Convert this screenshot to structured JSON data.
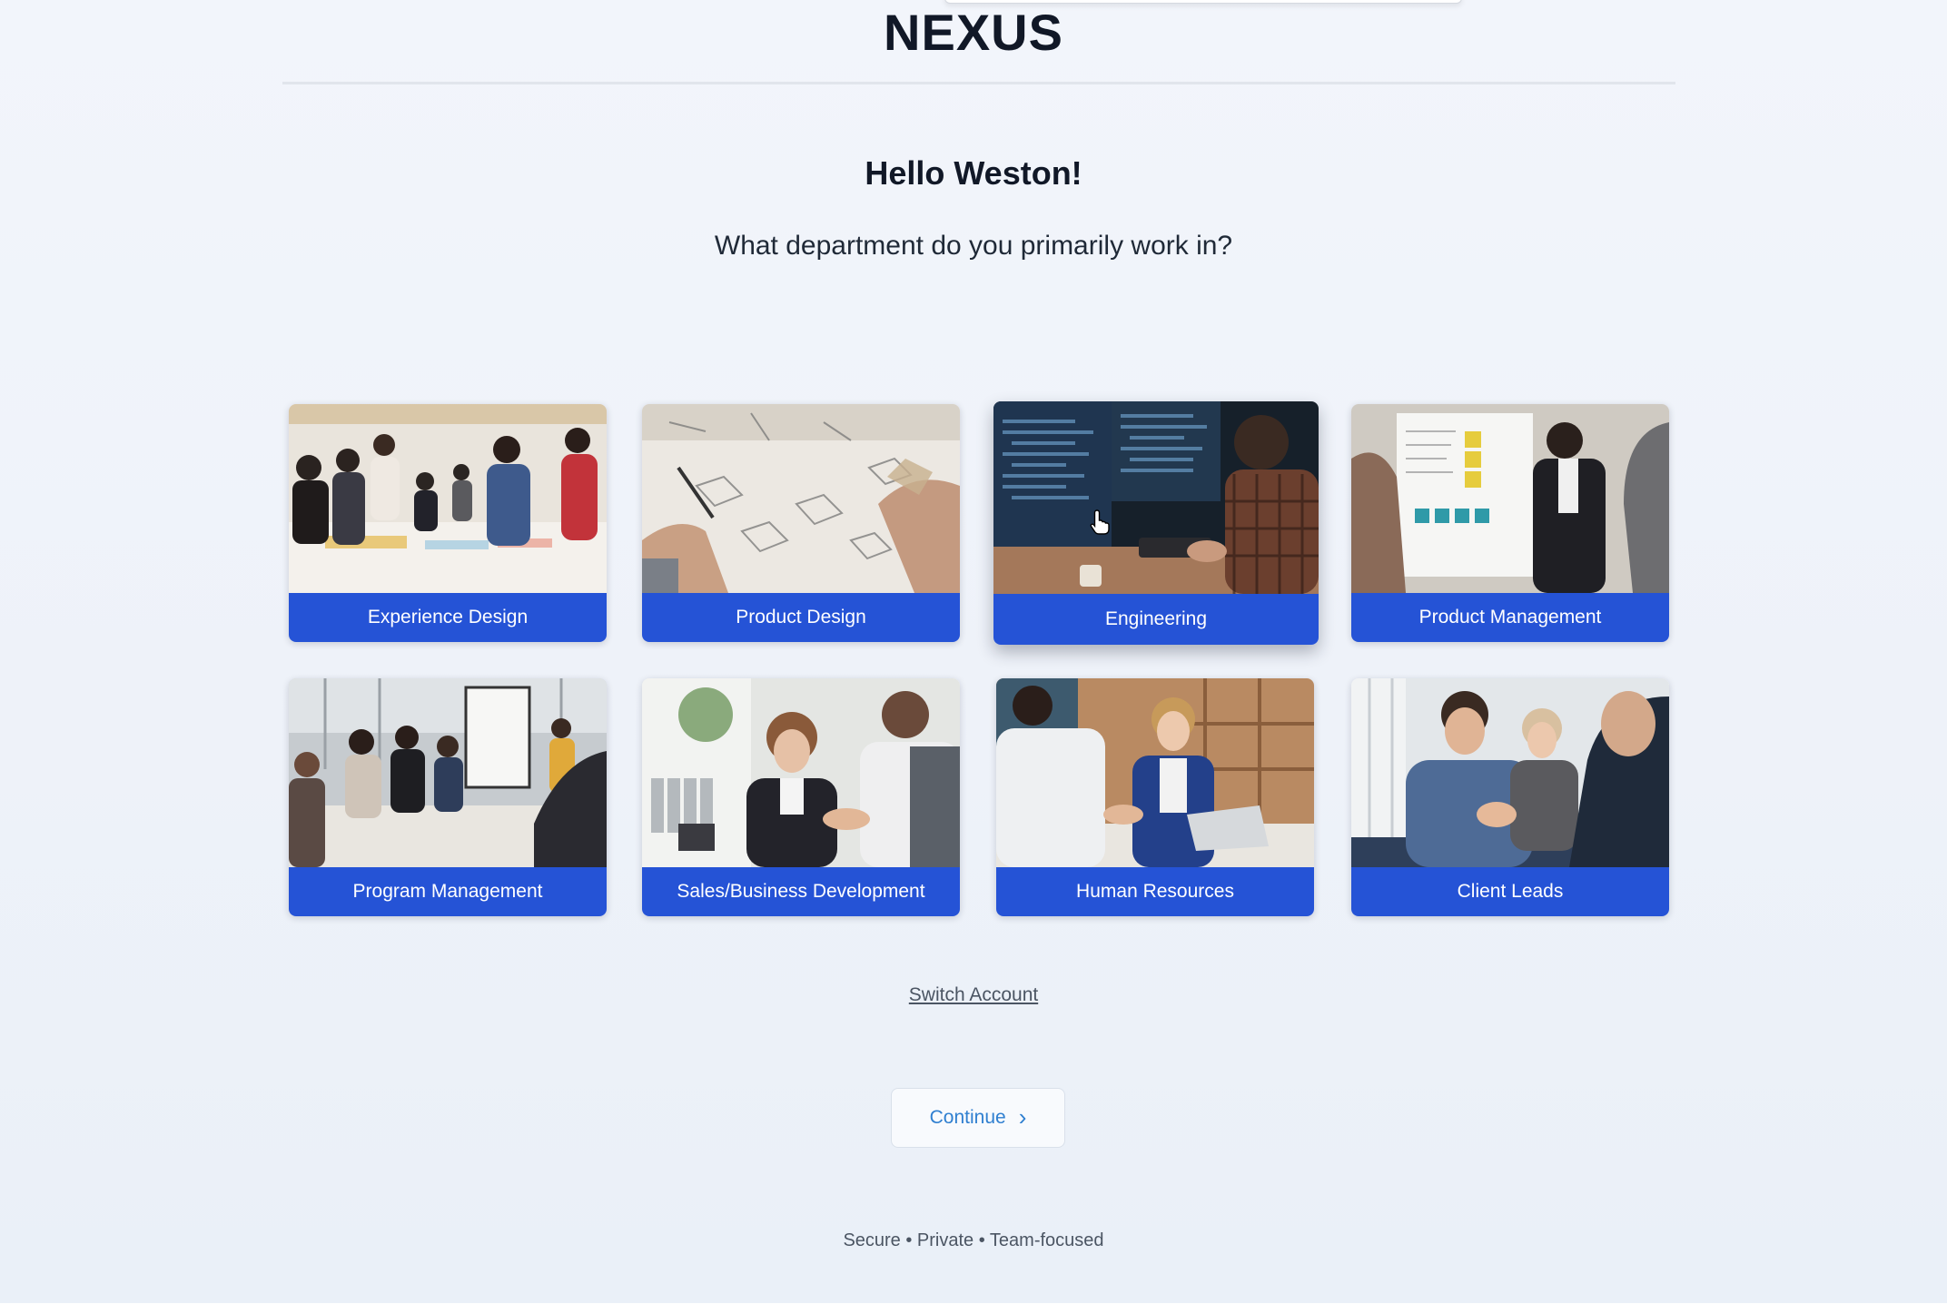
{
  "brand": "NEXUS",
  "greeting": "Hello Weston!",
  "question": "What department do you primarily work in?",
  "departments": [
    {
      "label": "Experience Design",
      "selected": false
    },
    {
      "label": "Product Design",
      "selected": false
    },
    {
      "label": "Engineering",
      "selected": true
    },
    {
      "label": "Product Management",
      "selected": false
    },
    {
      "label": "Program Management",
      "selected": false
    },
    {
      "label": "Sales/Business Development",
      "selected": false
    },
    {
      "label": "Human Resources",
      "selected": false
    },
    {
      "label": "Client Leads",
      "selected": false
    }
  ],
  "switch_account_label": "Switch Account",
  "continue_label": "Continue",
  "footer_text": "Secure • Private • Team-focused",
  "colors": {
    "accent": "#2553d6",
    "link": "#2f7fd0",
    "background": "#eef2f9"
  },
  "icons": {
    "continue": "chevron-right-icon",
    "cursor": "hand-pointer-icon"
  }
}
